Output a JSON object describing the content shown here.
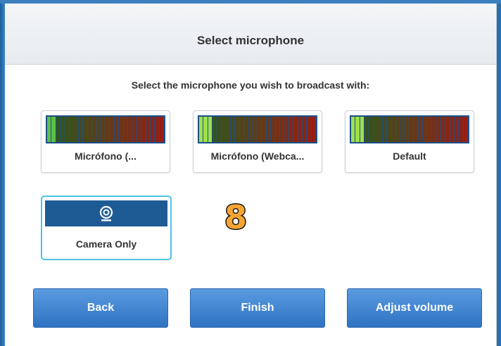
{
  "dialog": {
    "title": "Select microphone",
    "instruction": "Select the microphone you wish to broadcast with:"
  },
  "microphones": [
    {
      "label": "Micrófono (...",
      "meter_level": 0.06,
      "meter_color": "#5bbf4a"
    },
    {
      "label": "Micrófono (Webca...",
      "meter_level": 0.12,
      "meter_color": "#9ee04f"
    },
    {
      "label": "Default",
      "meter_level": 0.12,
      "meter_color": "#9ee04f"
    }
  ],
  "camera_option": {
    "label": "Camera Only",
    "icon": "webcam-icon"
  },
  "overlay": {
    "number": "8"
  },
  "buttons": {
    "back": "Back",
    "finish": "Finish",
    "adjust_volume": "Adjust volume"
  },
  "colors": {
    "accent_blue": "#2f73c2",
    "selected_border": "#4fc3e8",
    "meter_frame": "#1d4f86"
  }
}
